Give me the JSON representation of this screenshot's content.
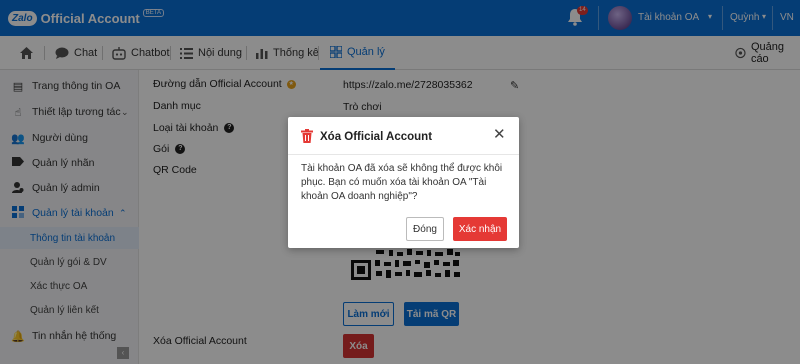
{
  "header": {
    "logo_badge": "Zalo",
    "app_title": "Official Account",
    "beta": "BETA",
    "notification_count": "14",
    "account_name": "Tài khoản OA",
    "user_name": "Quỳnh",
    "language": "VN"
  },
  "tabs": [
    {
      "label": "",
      "icon": "home-icon"
    },
    {
      "label": "Chat",
      "icon": "chat-icon"
    },
    {
      "label": "Chatbot",
      "icon": "chatbot-icon"
    },
    {
      "label": "Nội dung",
      "icon": "list-icon"
    },
    {
      "label": "Thống kê",
      "icon": "bar-chart-icon"
    },
    {
      "label": "Quản lý",
      "icon": "grid-icon"
    }
  ],
  "ads_label": "Quảng cáo",
  "sidebar": {
    "items": [
      {
        "label": "Trang thông tin OA",
        "icon": "doc-icon"
      },
      {
        "label": "Thiết lập tương tác",
        "icon": "pointer-icon"
      },
      {
        "label": "Người dùng",
        "icon": "users-icon"
      },
      {
        "label": "Quản lý nhãn",
        "icon": "tag-icon"
      },
      {
        "label": "Quản lý admin",
        "icon": "admin-icon"
      },
      {
        "label": "Quản lý tài khoản",
        "icon": "account-icon"
      }
    ],
    "subitems": [
      {
        "label": "Thông tin tài khoản"
      },
      {
        "label": "Quản lý gói & DV"
      },
      {
        "label": "Xác thực OA"
      },
      {
        "label": "Quản lý liên kết"
      }
    ],
    "last_item": "Tin nhắn hệ thống"
  },
  "content": {
    "rows": [
      {
        "label": "Đường dẫn Official Account",
        "value": "https://zalo.me/2728035362"
      },
      {
        "label": "Danh mục",
        "value": "Trò chơi"
      },
      {
        "label": "Loại tài khoản",
        "value": ""
      },
      {
        "label": "Gói",
        "value": ""
      },
      {
        "label": "QR Code",
        "value": ""
      }
    ],
    "refresh_button": "Làm mới",
    "download_qr_button": "Tải mã QR",
    "delete_label": "Xóa Official Account",
    "delete_button": "Xóa"
  },
  "modal": {
    "title": "Xóa Official Account",
    "body": "Tài khoản OA đã xóa sẽ không thể được khôi phục. Bạn có muốn xóa tài khoản OA \"Tài khoản OA doanh nghiệp\"?",
    "close_button": "Đóng",
    "confirm_button": "Xác nhận"
  },
  "colors": {
    "brand_blue": "#0a6fd6",
    "danger_red": "#e53935",
    "overlay": "rgba(0,0,0,0.45)"
  }
}
